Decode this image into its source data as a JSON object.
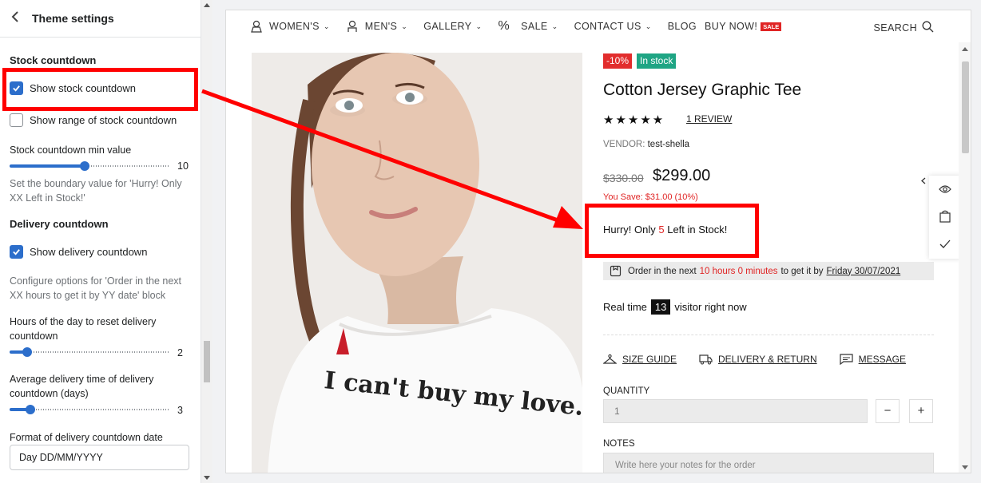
{
  "sidebar": {
    "title": "Theme settings",
    "stock_section": "Stock countdown",
    "show_stock_countdown": {
      "label": "Show stock countdown",
      "checked": true
    },
    "show_range": {
      "label": "Show range of stock countdown",
      "checked": false
    },
    "min_value": {
      "label": "Stock countdown min value",
      "value": "10",
      "fraction": 0.47
    },
    "min_help": "Set the boundary value for 'Hurry! Only XX Left in Stock!'",
    "delivery_section": "Delivery countdown",
    "show_delivery_countdown": {
      "label": "Show delivery countdown",
      "checked": true
    },
    "delivery_help": "Configure options for 'Order in the next XX hours to get it by YY date' block",
    "reset_hours": {
      "label": "Hours of the day to reset delivery countdown",
      "value": "2",
      "fraction": 0.11
    },
    "avg_delivery": {
      "label": "Average delivery time of delivery countdown (days)",
      "value": "3",
      "fraction": 0.13
    },
    "date_format": {
      "label": "Format of delivery countdown date",
      "value": "Day DD/MM/YYYY"
    }
  },
  "nav": {
    "items": [
      "WOMEN'S",
      "MEN'S",
      "GALLERY",
      "SALE",
      "CONTACT US",
      "BLOG",
      "BUY NOW!"
    ],
    "sale_badge": "SALE",
    "search": "SEARCH"
  },
  "product": {
    "discount_badge": "-10%",
    "stock_badge": "In stock",
    "title": "Cotton Jersey Graphic Tee",
    "stars": "★★★★★",
    "review_link": "1 REVIEW",
    "vendor_label": "VENDOR:",
    "vendor": "test-shella",
    "price_old": "$330.00",
    "price_new": "$299.00",
    "you_save": "You Save: $31.00 (10%)",
    "hurry_pre": "Hurry! Only",
    "hurry_num": "5",
    "hurry_post": "Left in Stock!",
    "delivery_pre": "Order in the next",
    "delivery_time": "10 hours 0 minutes",
    "delivery_mid": "to get it by",
    "delivery_date": "Friday 30/07/2021",
    "visitors_pre": "Real time",
    "visitors_count": "13",
    "visitors_post": "visitor right now",
    "size_guide": "SIZE GUIDE",
    "delivery_return": "DELIVERY & RETURN",
    "message": "MESSAGE",
    "quantity_label": "QUANTITY",
    "quantity_value": "1",
    "minus": "−",
    "plus": "+",
    "notes_label": "NOTES",
    "notes_placeholder": "Write here your notes for the order",
    "tshirt_print": "I can't buy my love."
  },
  "colors": {
    "accent": "#2c6ecb",
    "sale_red": "#e02424",
    "stock_green": "#1fa584",
    "annotation": "#ff0000"
  }
}
